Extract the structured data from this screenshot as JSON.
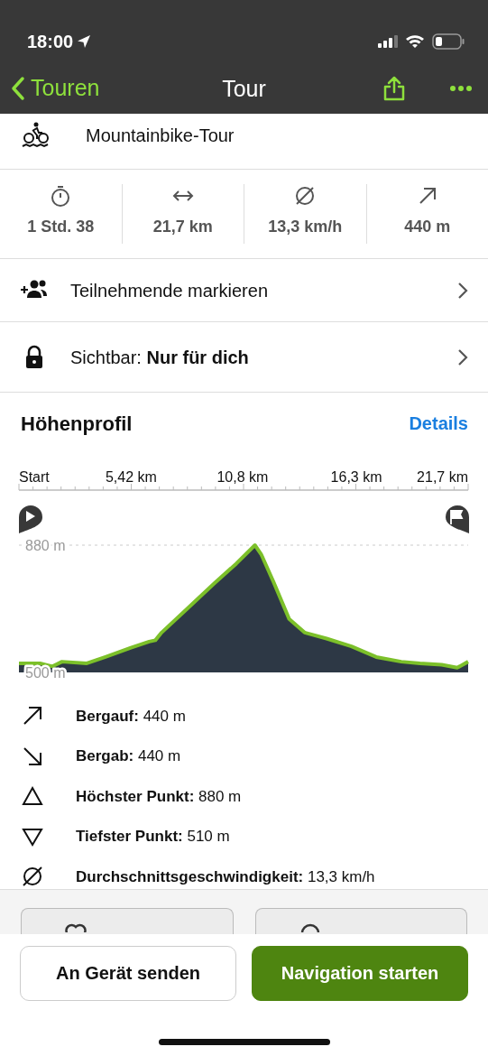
{
  "status_bar": {
    "time": "18:00"
  },
  "nav": {
    "back": "Touren",
    "title": "Tour"
  },
  "activity": {
    "label": "Mountainbike-Tour"
  },
  "stats": [
    {
      "kind": "duration",
      "value": "1 Std. 38"
    },
    {
      "kind": "distance",
      "value": "21,7 km"
    },
    {
      "kind": "speed",
      "value": "13,3 km/h"
    },
    {
      "kind": "ascent",
      "value": "440 m"
    }
  ],
  "rows": [
    {
      "kind": "participants",
      "text": "Teilnehmende markieren"
    },
    {
      "kind": "visibility",
      "text": "Sichtbar: **Nur für dich**"
    }
  ],
  "profile": {
    "title": "Höhenprofil",
    "link": "Details",
    "chart_data": {
      "type": "area",
      "x": [
        0,
        1.02,
        1.62,
        2.08,
        3.28,
        4.18,
        5.38,
        6.29,
        6.59,
        6.89,
        8.09,
        9.44,
        10.5,
        11.4,
        11.7,
        12.3,
        13.05,
        13.8,
        14.86,
        16.06,
        17.26,
        18.47,
        19.37,
        20.42,
        21.17,
        21.7
      ],
      "series": [
        {
          "color": "#7cc02a",
          "values": [
            527,
            527,
            518,
            532,
            527,
            546,
            573,
            592,
            596,
            619,
            688,
            766,
            825,
            880,
            853,
            770,
            660,
            619,
            601,
            578,
            546,
            532,
            527,
            523,
            514,
            532
          ]
        }
      ],
      "xlim": [
        0,
        21.7
      ],
      "ylim": [
        500,
        880
      ],
      "xticks": [
        {
          "value": 0,
          "label": "Start"
        },
        {
          "value": 5.42,
          "label": "5,42 km"
        },
        {
          "value": 10.8,
          "label": "10,8 km"
        },
        {
          "value": 16.3,
          "label": "16,3 km"
        },
        {
          "value": 21.7,
          "label": "21,7 km"
        }
      ],
      "yticks": [
        {
          "value": 880,
          "label": "880 m"
        },
        {
          "value": 500,
          "label": "500 m"
        }
      ]
    }
  },
  "details": [
    {
      "kind": "up",
      "text": "**Bergauf:** 440 m"
    },
    {
      "kind": "down",
      "text": "**Bergab:** 440 m"
    },
    {
      "kind": "highest",
      "text": "**Höchster Punkt:** 880 m"
    },
    {
      "kind": "lowest",
      "text": "**Tiefster Punkt:** 510 m"
    },
    {
      "kind": "speed",
      "text": "**Durchschnittsgeschwindigkeit:** 13,3 km/h"
    }
  ],
  "actions": [
    {
      "kind": "like"
    },
    {
      "kind": "comment"
    }
  ],
  "buttons": [
    {
      "kind": "secondary",
      "label": "An Gerät senden"
    },
    {
      "kind": "primary",
      "label": "Navigation starten"
    }
  ]
}
